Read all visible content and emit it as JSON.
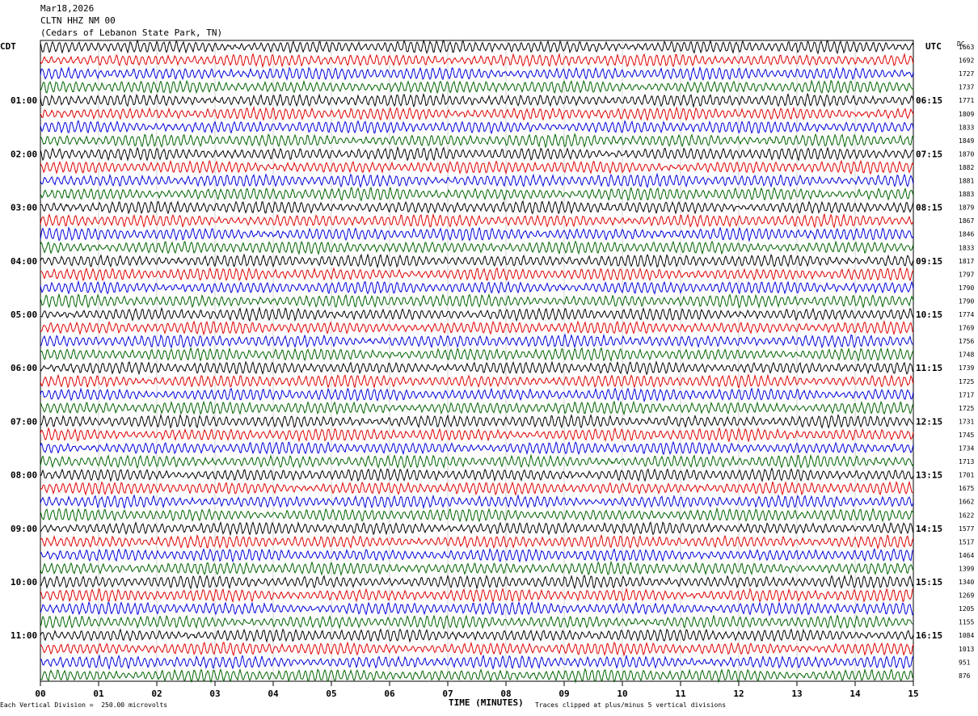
{
  "header": {
    "date": "Mar18,2026",
    "station": "CLTN HHZ NM 00",
    "location": "(Cedars of Lebanon State Park, TN)"
  },
  "left_timezone": "CDT",
  "right_timezone": "UTC",
  "right_column_header": "DC",
  "colors": [
    "#000000",
    "#e00000",
    "#0000dd",
    "#006400"
  ],
  "chart_data": {
    "type": "line",
    "description_of_axes": "helicorder",
    "xlabel": "TIME (MINUTES)",
    "x_ticks": [
      "00",
      "01",
      "02",
      "03",
      "04",
      "05",
      "06",
      "07",
      "08",
      "09",
      "10",
      "11",
      "12",
      "13",
      "14",
      "15"
    ],
    "xlim": [
      0,
      15
    ],
    "left_time_labels": [
      "01:00",
      "02:00",
      "03:00",
      "04:00",
      "05:00",
      "06:00",
      "07:00",
      "08:00",
      "09:00",
      "10:00",
      "11:00"
    ],
    "right_time_labels": [
      "06:15",
      "07:15",
      "08:15",
      "09:15",
      "10:15",
      "11:15",
      "12:15",
      "13:15",
      "14:15",
      "15:15",
      "16:15"
    ],
    "trace_count": 48,
    "dc_offsets": [
      1663,
      1692,
      1727,
      1737,
      1771,
      1809,
      1833,
      1849,
      1870,
      1882,
      1881,
      1883,
      1879,
      1867,
      1846,
      1833,
      1817,
      1797,
      1790,
      1790,
      1774,
      1769,
      1756,
      1748,
      1739,
      1725,
      1717,
      1725,
      1731,
      1745,
      1734,
      1713,
      1701,
      1675,
      1662,
      1622,
      1577,
      1517,
      1464,
      1399,
      1340,
      1269,
      1205,
      1155,
      1084,
      1013,
      951,
      876
    ],
    "scale_note": "Each Vertical Division =  250.00 microvolts",
    "clip_note": "Traces clipped at plus/minus 5 vertical divisions"
  }
}
